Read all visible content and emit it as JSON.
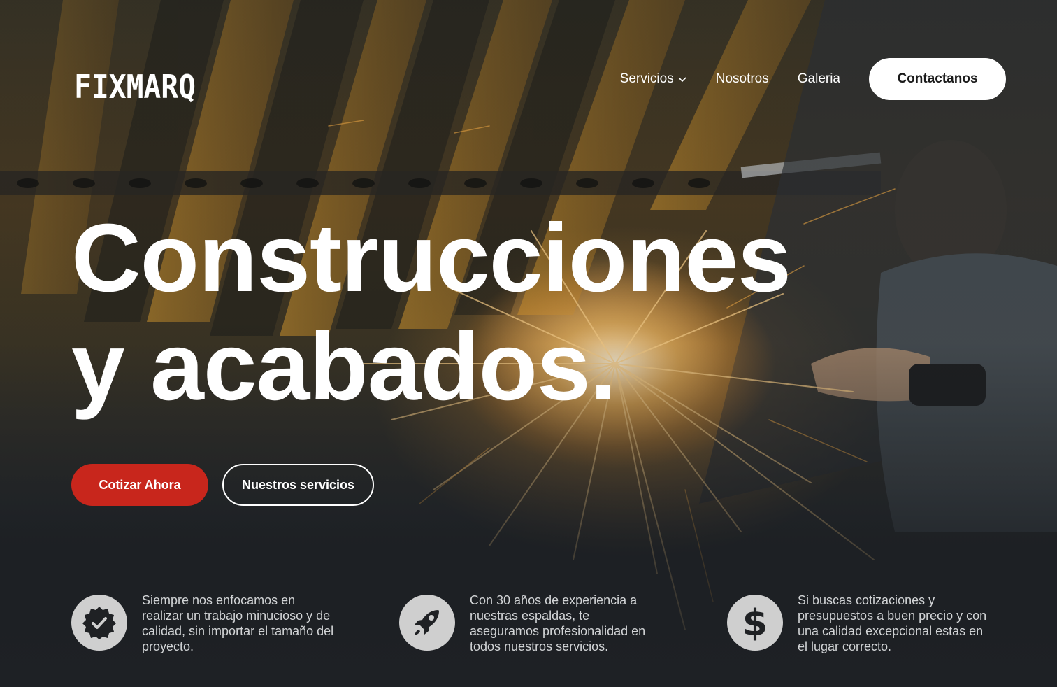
{
  "brand": {
    "logo_text": "FIXMARQ"
  },
  "nav": {
    "items": [
      {
        "label": "Servicios",
        "has_dropdown": true
      },
      {
        "label": "Nosotros",
        "has_dropdown": false
      },
      {
        "label": "Galeria",
        "has_dropdown": false
      }
    ],
    "contact_label": "Contactanos"
  },
  "hero": {
    "headline_line1": "Construcciones",
    "headline_line2": "y acabados.",
    "primary_cta": "Cotizar Ahora",
    "secondary_cta": "Nuestros servicios"
  },
  "features": [
    {
      "icon": "badge-check-icon",
      "text": "Siempre nos enfocamos en realizar un trabajo minucioso y de calidad, sin importar el tamaño del proyecto."
    },
    {
      "icon": "rocket-icon",
      "text": "Con 30 años de experiencia a nuestras espaldas, te aseguramos profesionalidad en todos nuestros servicios."
    },
    {
      "icon": "dollar-icon",
      "text": "Si buscas cotizaciones y presupuestos a buen precio y con una calidad excepcional estas en el lugar correcto."
    }
  ],
  "colors": {
    "accent_red": "#c8261c",
    "button_white": "#ffffff",
    "icon_circle": "#cfcfcf",
    "feature_text": "#d2d4d6"
  }
}
